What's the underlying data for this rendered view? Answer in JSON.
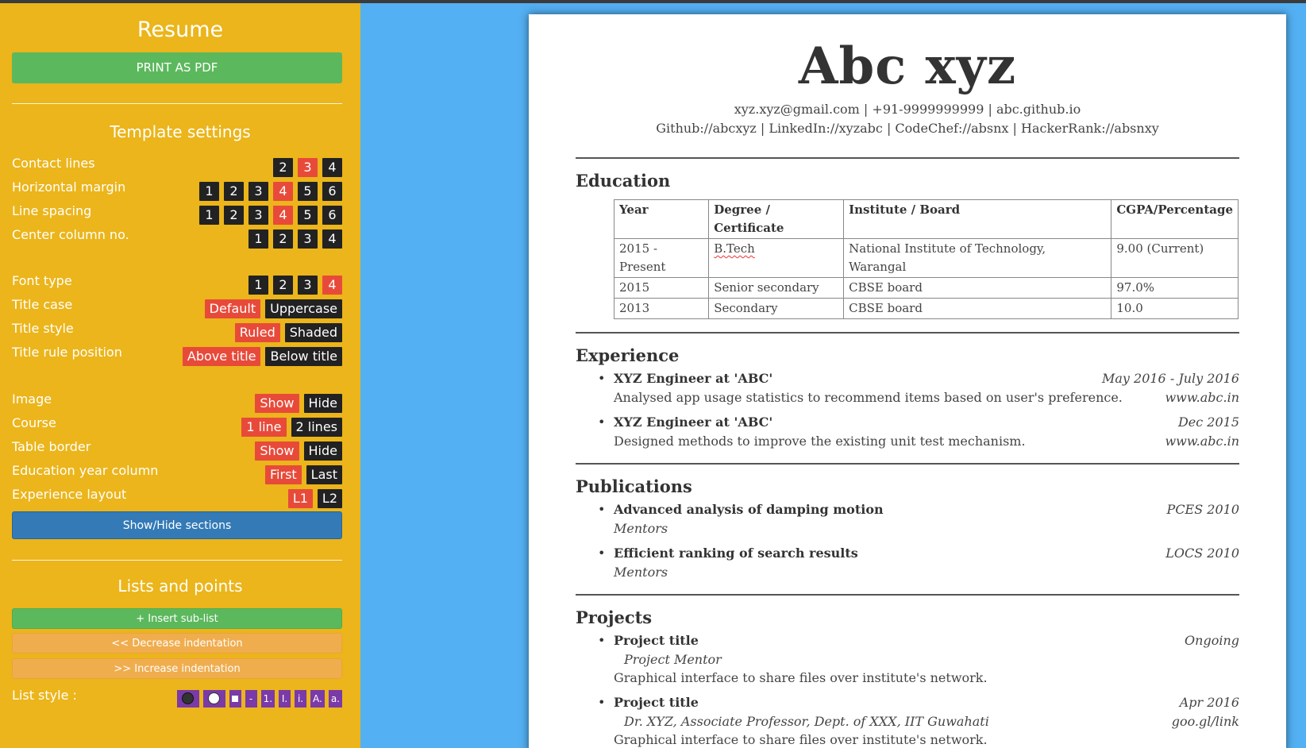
{
  "sidebar": {
    "title": "Resume",
    "print_button": "PRINT AS PDF",
    "template_settings_title": "Template settings",
    "settings": [
      {
        "label": "Contact lines",
        "options": [
          "2",
          "3",
          "4"
        ],
        "selected": "3"
      },
      {
        "label": "Horizontal margin",
        "options": [
          "1",
          "2",
          "3",
          "4",
          "5",
          "6"
        ],
        "selected": "4"
      },
      {
        "label": "Line spacing",
        "options": [
          "1",
          "2",
          "3",
          "4",
          "5",
          "6"
        ],
        "selected": "4"
      },
      {
        "label": "Center column no.",
        "options": [
          "1",
          "2",
          "3",
          "4"
        ],
        "selected": ""
      },
      {
        "label": "Font type",
        "options": [
          "1",
          "2",
          "3",
          "4"
        ],
        "selected": "4"
      },
      {
        "label": "Title case",
        "options": [
          "Default",
          "Uppercase"
        ],
        "selected": "Default"
      },
      {
        "label": "Title style",
        "options": [
          "Ruled",
          "Shaded"
        ],
        "selected": "Ruled"
      },
      {
        "label": "Title rule position",
        "options": [
          "Above title",
          "Below title"
        ],
        "selected": "Above title"
      },
      {
        "label": "Image",
        "options": [
          "Show",
          "Hide"
        ],
        "selected": "Show"
      },
      {
        "label": "Course",
        "options": [
          "1 line",
          "2 lines"
        ],
        "selected": "1 line"
      },
      {
        "label": "Table border",
        "options": [
          "Show",
          "Hide"
        ],
        "selected": "Show"
      },
      {
        "label": "Education year column",
        "options": [
          "First",
          "Last"
        ],
        "selected": "First"
      },
      {
        "label": "Experience layout",
        "options": [
          "L1",
          "L2"
        ],
        "selected": "L1"
      }
    ],
    "show_hide_button": "Show/Hide sections",
    "lists_title": "Lists and points",
    "insert_sublist": "+ Insert sub-list",
    "decrease_indent": "<< Decrease indentation",
    "increase_indent": ">> Increase indentation",
    "list_style_label": "List style :",
    "list_styles": [
      "disc",
      "circle",
      "square",
      "-",
      "1.",
      "I.",
      "i.",
      "A.",
      "a."
    ],
    "colors": {
      "sidebar_bg": "#ebb51b",
      "selected": "#e84a3a",
      "unselected": "#222222",
      "green": "#5cb85c",
      "blue": "#337ab7",
      "orange": "#f0ad4e",
      "purple": "#7a3aa8"
    }
  },
  "resume": {
    "name": "Abc xyz",
    "contact_line1": "xyz.xyz@gmail.com | +91-9999999999 | abc.github.io",
    "contact_line2": "Github://abcxyz | LinkedIn://xyzabc | CodeChef://absnx | HackerRank://absnxy",
    "education": {
      "title": "Education",
      "headers": [
        "Year",
        "Degree / Certificate",
        "Institute / Board",
        "CGPA/Percentage"
      ],
      "rows": [
        [
          "2015 - Present",
          "B.Tech",
          "National Institute of Technology, Warangal",
          "9.00 (Current)"
        ],
        [
          "2015",
          "Senior secondary",
          "CBSE board",
          "97.0%"
        ],
        [
          "2013",
          "Secondary",
          "CBSE board",
          "10.0"
        ]
      ]
    },
    "experience": {
      "title": "Experience",
      "items": [
        {
          "role": "XYZ Engineer at 'ABC'",
          "date": "May 2016 - July 2016",
          "desc": "Analysed app usage statistics to recommend items based on user's preference.",
          "link": "www.abc.in"
        },
        {
          "role": "XYZ Engineer at 'ABC'",
          "date": "Dec 2015",
          "desc": "Designed methods to improve the existing unit test mechanism.",
          "link": "www.abc.in"
        }
      ]
    },
    "publications": {
      "title": "Publications",
      "items": [
        {
          "title": "Advanced analysis of damping motion",
          "venue": "PCES 2010",
          "sub": "Mentors"
        },
        {
          "title": "Efficient ranking of search results",
          "venue": "LOCS 2010",
          "sub": "Mentors"
        }
      ]
    },
    "projects": {
      "title": "Projects",
      "items": [
        {
          "title": "Project title",
          "status": "Ongoing",
          "mentor": "Project Mentor",
          "desc": "Graphical interface to share files over institute's network.",
          "link": ""
        },
        {
          "title": "Project title",
          "status": "Apr 2016",
          "mentor": "Dr. XYZ, Associate Professor, Dept. of XXX, IIT Guwahati",
          "desc": "Graphical interface to share files over institute's network.",
          "link": "goo.gl/link"
        }
      ]
    }
  }
}
